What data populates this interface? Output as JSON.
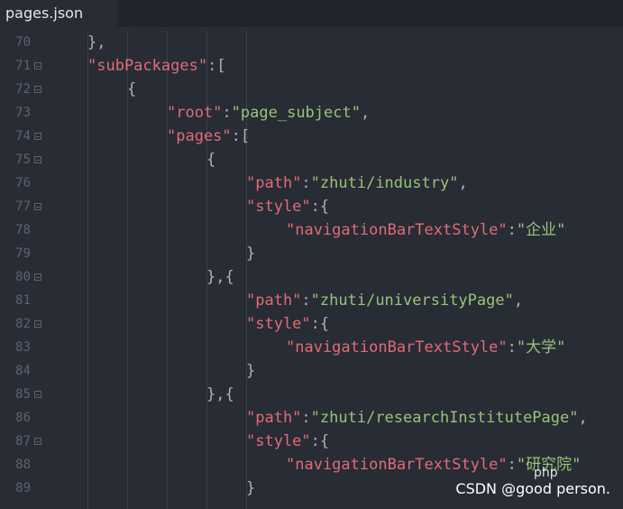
{
  "tab": {
    "label": "pages.json"
  },
  "watermark": {
    "csdn": "CSDN @good person.",
    "php": "php"
  },
  "lines": [
    {
      "n": "70",
      "indent": 2,
      "parts": [
        [
          "p",
          "},"
        ]
      ],
      "fold": false
    },
    {
      "n": "71",
      "indent": 2,
      "parts": [
        [
          "k",
          "\"subPackages\""
        ],
        [
          "p",
          ":["
        ]
      ],
      "fold": true
    },
    {
      "n": "72",
      "indent": 4,
      "parts": [
        [
          "p",
          "{"
        ]
      ],
      "fold": true
    },
    {
      "n": "73",
      "indent": 6,
      "parts": [
        [
          "k",
          "\"root\""
        ],
        [
          "p",
          ":"
        ],
        [
          "s",
          "\"page_subject\""
        ],
        [
          "p",
          ","
        ]
      ],
      "fold": false
    },
    {
      "n": "74",
      "indent": 6,
      "parts": [
        [
          "k",
          "\"pages\""
        ],
        [
          "p",
          ":["
        ]
      ],
      "fold": true
    },
    {
      "n": "75",
      "indent": 8,
      "parts": [
        [
          "p",
          "{"
        ]
      ],
      "fold": true
    },
    {
      "n": "76",
      "indent": 10,
      "parts": [
        [
          "k",
          "\"path\""
        ],
        [
          "p",
          ":"
        ],
        [
          "s",
          "\"zhuti/industry\""
        ],
        [
          "p",
          ","
        ]
      ],
      "fold": false
    },
    {
      "n": "77",
      "indent": 10,
      "parts": [
        [
          "k",
          "\"style\""
        ],
        [
          "p",
          ":{"
        ]
      ],
      "fold": true
    },
    {
      "n": "78",
      "indent": 12,
      "parts": [
        [
          "k",
          "\"navigationBarTextStyle\""
        ],
        [
          "p",
          ":"
        ],
        [
          "s",
          "\"企业\""
        ]
      ],
      "fold": false
    },
    {
      "n": "79",
      "indent": 10,
      "parts": [
        [
          "p",
          "}"
        ]
      ],
      "fold": false
    },
    {
      "n": "80",
      "indent": 8,
      "parts": [
        [
          "p",
          "},{"
        ]
      ],
      "fold": true
    },
    {
      "n": "81",
      "indent": 10,
      "parts": [
        [
          "k",
          "\"path\""
        ],
        [
          "p",
          ":"
        ],
        [
          "s",
          "\"zhuti/universityPage\""
        ],
        [
          "p",
          ","
        ]
      ],
      "fold": false
    },
    {
      "n": "82",
      "indent": 10,
      "parts": [
        [
          "k",
          "\"style\""
        ],
        [
          "p",
          ":{"
        ]
      ],
      "fold": true
    },
    {
      "n": "83",
      "indent": 12,
      "parts": [
        [
          "k",
          "\"navigationBarTextStyle\""
        ],
        [
          "p",
          ":"
        ],
        [
          "s",
          "\"大学\""
        ]
      ],
      "fold": false
    },
    {
      "n": "84",
      "indent": 10,
      "parts": [
        [
          "p",
          "}"
        ]
      ],
      "fold": false
    },
    {
      "n": "85",
      "indent": 8,
      "parts": [
        [
          "p",
          "},{"
        ]
      ],
      "fold": true
    },
    {
      "n": "86",
      "indent": 10,
      "parts": [
        [
          "k",
          "\"path\""
        ],
        [
          "p",
          ":"
        ],
        [
          "s",
          "\"zhuti/researchInstitutePage\""
        ],
        [
          "p",
          ","
        ]
      ],
      "fold": false
    },
    {
      "n": "87",
      "indent": 10,
      "parts": [
        [
          "k",
          "\"style\""
        ],
        [
          "p",
          ":{"
        ]
      ],
      "fold": true
    },
    {
      "n": "88",
      "indent": 12,
      "parts": [
        [
          "k",
          "\"navigationBarTextStyle\""
        ],
        [
          "p",
          ":"
        ],
        [
          "s",
          "\"研究院\""
        ]
      ],
      "fold": false
    },
    {
      "n": "89",
      "indent": 10,
      "parts": [
        [
          "p",
          "}"
        ]
      ],
      "fold": false
    }
  ]
}
